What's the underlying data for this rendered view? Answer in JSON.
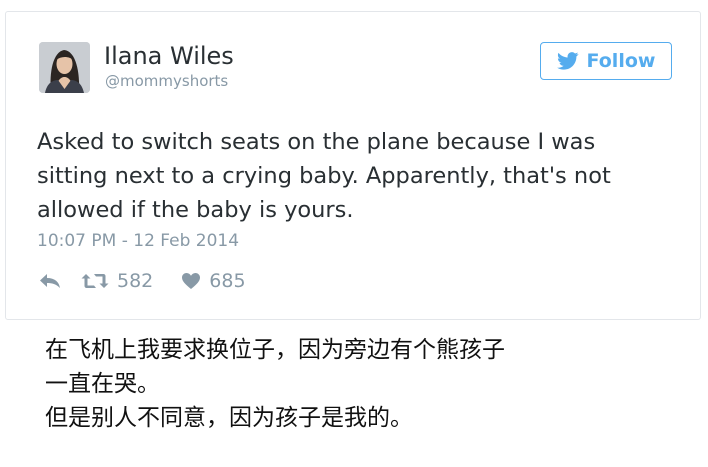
{
  "tweet": {
    "author_name": "Ilana Wiles",
    "author_handle": "@mommyshorts",
    "follow_label": "Follow",
    "text_lines": [
      "Asked to switch seats on the plane because I was",
      "sitting next to a crying baby. Apparently, that's not",
      "allowed if the baby is yours."
    ],
    "timestamp": "10:07 PM - 12 Feb 2014",
    "retweets": "582",
    "likes": "685",
    "icons": {
      "avatar": "profile-photo",
      "follow": "twitter-bird-icon",
      "reply": "reply-icon",
      "retweet": "retweet-icon",
      "like": "heart-icon"
    },
    "colors": {
      "brand": "#55acee",
      "text": "#292f33",
      "muted": "#8899a6"
    }
  },
  "caption": {
    "lines": [
      "在飞机上我要求换位子，因为旁边有个熊孩子",
      "一直在哭。",
      "但是别人不同意，因为孩子是我的。"
    ]
  }
}
